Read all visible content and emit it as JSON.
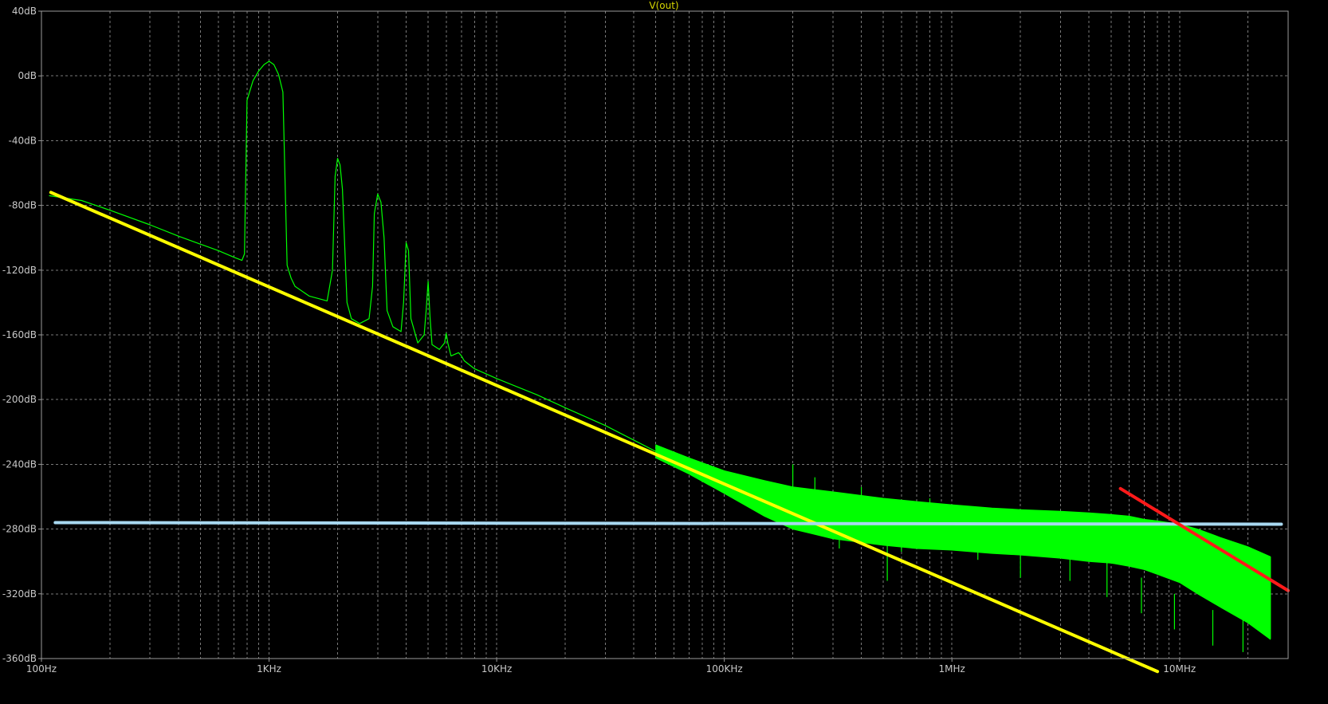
{
  "chart_data": {
    "type": "line",
    "title": "V(out)",
    "xscale": "log",
    "xlim": [
      100,
      30000000
    ],
    "ylim": [
      -360,
      40
    ],
    "grid": true,
    "x_tick_labels": [
      {
        "value": 100,
        "label": "100Hz"
      },
      {
        "value": 1000,
        "label": "1KHz"
      },
      {
        "value": 10000,
        "label": "10KHz"
      },
      {
        "value": 100000,
        "label": "100KHz"
      },
      {
        "value": 1000000,
        "label": "1MHz"
      },
      {
        "value": 10000000,
        "label": "10MHz"
      }
    ],
    "y_tick_labels": [
      {
        "value": 40,
        "label": "40dB"
      },
      {
        "value": 0,
        "label": "0dB"
      },
      {
        "value": -40,
        "label": "-40dB"
      },
      {
        "value": -80,
        "label": "-80dB"
      },
      {
        "value": -120,
        "label": "-120dB"
      },
      {
        "value": -160,
        "label": "-160dB"
      },
      {
        "value": -200,
        "label": "-200dB"
      },
      {
        "value": -240,
        "label": "-240dB"
      },
      {
        "value": -280,
        "label": "-280dB"
      },
      {
        "value": -320,
        "label": "-320dB"
      },
      {
        "value": -360,
        "label": "-360dB"
      }
    ],
    "series": [
      {
        "color": "#00ff00",
        "x": [
          108,
          150,
          200,
          300,
          400,
          500,
          600,
          700,
          760,
          780,
          800,
          850,
          900,
          950,
          1000,
          1050,
          1100,
          1150,
          1200,
          1250,
          1300,
          1500,
          1800,
          1900,
          1950,
          2000,
          2050,
          2100,
          2200,
          2250,
          2300,
          2500,
          2750,
          2850,
          2900,
          3000,
          3100,
          3200,
          3300,
          3500,
          3800,
          3900,
          4000,
          4100,
          4200,
          4500,
          4800,
          4900,
          5000,
          5100,
          5200,
          5600,
          5900,
          6000,
          6100,
          6300,
          6800,
          7000,
          7200,
          8000,
          10000,
          15000,
          20000,
          30000,
          50000
        ],
        "y": [
          -74,
          -77,
          -83,
          -92,
          -99,
          -104,
          -108,
          -112,
          -114,
          -110,
          -15,
          -3,
          3,
          7,
          9,
          7,
          1,
          -10,
          -117,
          -125,
          -130,
          -136,
          -139,
          -120,
          -62,
          -51,
          -55,
          -70,
          -140,
          -145,
          -150,
          -153,
          -150,
          -130,
          -85,
          -73,
          -78,
          -100,
          -145,
          -155,
          -158,
          -140,
          -103,
          -108,
          -150,
          -165,
          -160,
          -145,
          -127,
          -150,
          -166,
          -169,
          -165,
          -159,
          -165,
          -173,
          -171,
          -173,
          -176,
          -181,
          -187,
          -197,
          -205,
          -216,
          -232
        ]
      },
      {
        "color": "#00ff00",
        "fill_band": true,
        "x": [
          50000,
          70000,
          100000,
          150000,
          200000,
          300000,
          500000,
          700000,
          1000000,
          1500000,
          2000000,
          3000000,
          4000000,
          5000000,
          6000000,
          7000000,
          8000000,
          10000000,
          12000000,
          15000000,
          20000000,
          25000000
        ],
        "y_upper": [
          -228,
          -236,
          -244,
          -250,
          -254,
          -257,
          -261,
          -263,
          -265,
          -267,
          -268,
          -269,
          -270,
          -271,
          -272,
          -274,
          -275,
          -277,
          -280,
          -285,
          -291,
          -297
        ],
        "y_lower": [
          -236,
          -246,
          -258,
          -272,
          -280,
          -286,
          -290,
          -292,
          -293,
          -295,
          -296,
          -298,
          -300,
          -301,
          -303,
          -305,
          -308,
          -313,
          -320,
          -328,
          -338,
          -348
        ]
      },
      {
        "color": "#ffff00",
        "x": [
          110,
          8000000
        ],
        "y": [
          -72,
          -368
        ]
      },
      {
        "color": "#a8d8f0",
        "x": [
          115,
          28000000
        ],
        "y": [
          -276,
          -277
        ]
      },
      {
        "color": "#ff1a1a",
        "x": [
          5500000,
          30000000
        ],
        "y": [
          -255,
          -318
        ]
      }
    ],
    "spikes": [
      {
        "x": 200000,
        "y": -262
      },
      {
        "x": 250000,
        "y": -270
      },
      {
        "x": 320000,
        "y": -292
      },
      {
        "x": 400000,
        "y": -276
      },
      {
        "x": 520000,
        "y": -312
      },
      {
        "x": 600000,
        "y": -294
      },
      {
        "x": 800000,
        "y": -283
      },
      {
        "x": 1300000,
        "y": -299
      },
      {
        "x": 2000000,
        "y": -310
      },
      {
        "x": 3300000,
        "y": -312
      },
      {
        "x": 4800000,
        "y": -322
      },
      {
        "x": 6800000,
        "y": -332
      },
      {
        "x": 9500000,
        "y": -342
      },
      {
        "x": 14000000,
        "y": -352
      },
      {
        "x": 19000000,
        "y": -356
      }
    ]
  }
}
